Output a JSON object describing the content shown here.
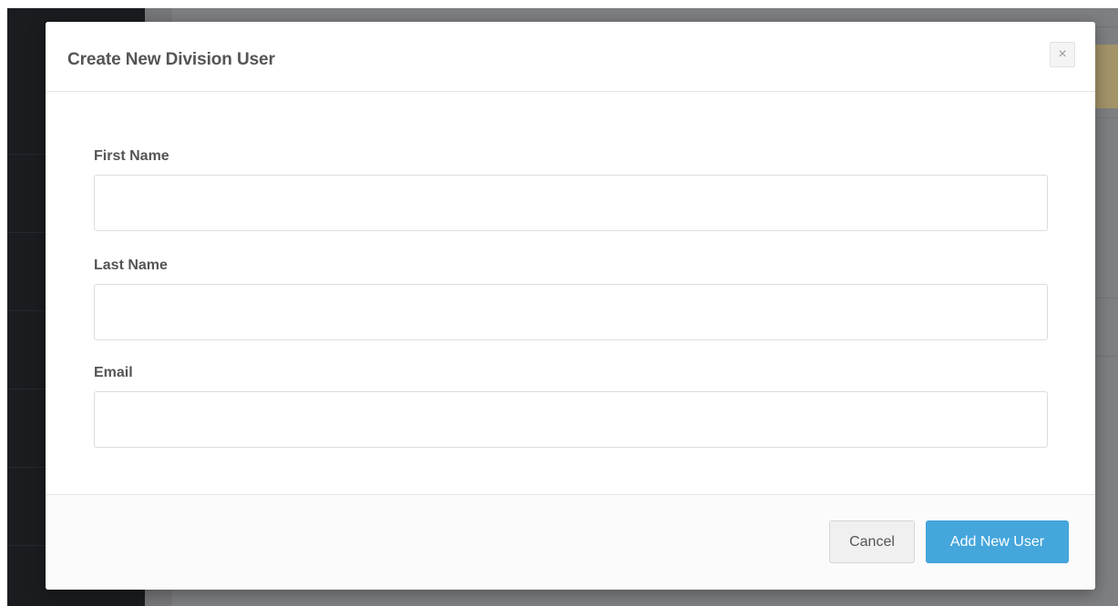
{
  "modal": {
    "title": "Create New Division User",
    "close_glyph": "×"
  },
  "form": {
    "first_name": {
      "label": "First Name",
      "value": "",
      "placeholder": ""
    },
    "last_name": {
      "label": "Last Name",
      "value": "",
      "placeholder": ""
    },
    "email": {
      "label": "Email",
      "value": "",
      "placeholder": ""
    }
  },
  "footer": {
    "cancel_label": "Cancel",
    "submit_label": "Add New User"
  },
  "colors": {
    "primary": "#45a6dc",
    "overlay": "#7d7e81",
    "sidebar": "#1a1c20"
  }
}
